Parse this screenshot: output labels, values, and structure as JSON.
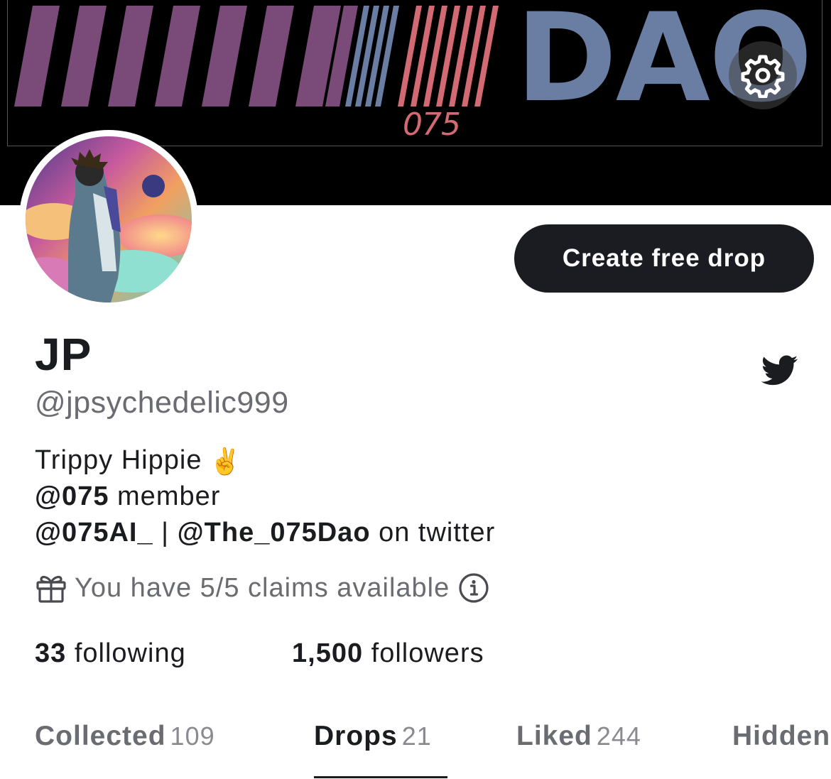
{
  "banner": {
    "subtitle": "075",
    "title": "DAO",
    "colors": {
      "purple": "#7a4a78",
      "blue": "#6a7ea3",
      "red": "#d26a73",
      "background": "#000000"
    }
  },
  "settings": {
    "icon": "gear-icon"
  },
  "actions": {
    "create_drop_label": "Create free drop"
  },
  "profile": {
    "name": "JP",
    "handle": "@jpsychedelic999",
    "bio_line1": "Trippy Hippie",
    "bio_line1_emoji": "✌️",
    "bio_line2_mention": "@075",
    "bio_line2_text": "member",
    "bio_line3_mention1": "@075AI_",
    "bio_line3_sep": "|",
    "bio_line3_mention2": "@The_075Dao",
    "bio_line3_text": "on twitter",
    "social_icon": "twitter-icon"
  },
  "claims": {
    "text": "You have 5/5 claims available",
    "gift_icon": "gift-icon",
    "info_icon": "info-icon"
  },
  "stats": {
    "following_count": "33",
    "following_label": "following",
    "followers_count": "1,500",
    "followers_label": "followers"
  },
  "tabs": [
    {
      "label": "Collected",
      "count": "109"
    },
    {
      "label": "Drops",
      "count": "21"
    },
    {
      "label": "Liked",
      "count": "244"
    },
    {
      "label": "Hidden",
      "count": ""
    }
  ],
  "active_tab": "Drops"
}
